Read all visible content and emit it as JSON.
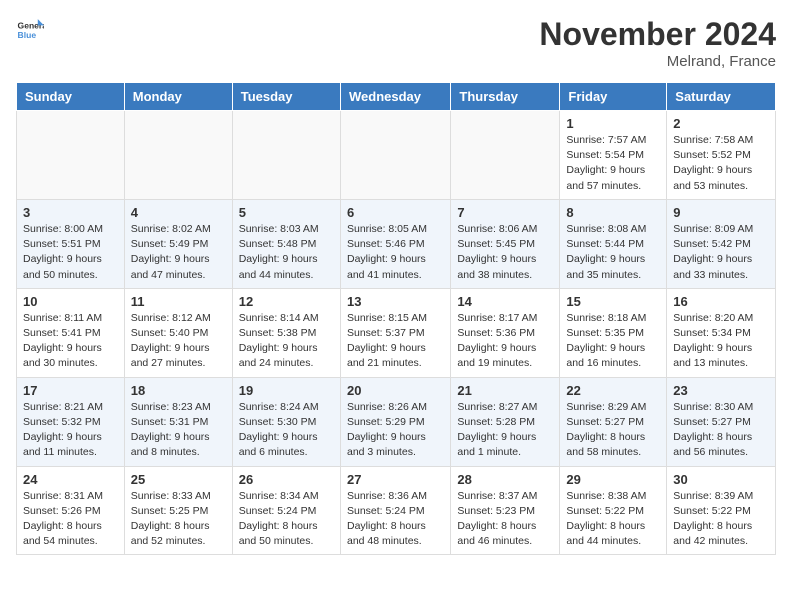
{
  "header": {
    "logo_line1": "General",
    "logo_line2": "Blue",
    "month_title": "November 2024",
    "location": "Melrand, France"
  },
  "days_of_week": [
    "Sunday",
    "Monday",
    "Tuesday",
    "Wednesday",
    "Thursday",
    "Friday",
    "Saturday"
  ],
  "weeks": [
    {
      "alt": false,
      "days": [
        {
          "num": "",
          "info": ""
        },
        {
          "num": "",
          "info": ""
        },
        {
          "num": "",
          "info": ""
        },
        {
          "num": "",
          "info": ""
        },
        {
          "num": "",
          "info": ""
        },
        {
          "num": "1",
          "info": "Sunrise: 7:57 AM\nSunset: 5:54 PM\nDaylight: 9 hours\nand 57 minutes."
        },
        {
          "num": "2",
          "info": "Sunrise: 7:58 AM\nSunset: 5:52 PM\nDaylight: 9 hours\nand 53 minutes."
        }
      ]
    },
    {
      "alt": true,
      "days": [
        {
          "num": "3",
          "info": "Sunrise: 8:00 AM\nSunset: 5:51 PM\nDaylight: 9 hours\nand 50 minutes."
        },
        {
          "num": "4",
          "info": "Sunrise: 8:02 AM\nSunset: 5:49 PM\nDaylight: 9 hours\nand 47 minutes."
        },
        {
          "num": "5",
          "info": "Sunrise: 8:03 AM\nSunset: 5:48 PM\nDaylight: 9 hours\nand 44 minutes."
        },
        {
          "num": "6",
          "info": "Sunrise: 8:05 AM\nSunset: 5:46 PM\nDaylight: 9 hours\nand 41 minutes."
        },
        {
          "num": "7",
          "info": "Sunrise: 8:06 AM\nSunset: 5:45 PM\nDaylight: 9 hours\nand 38 minutes."
        },
        {
          "num": "8",
          "info": "Sunrise: 8:08 AM\nSunset: 5:44 PM\nDaylight: 9 hours\nand 35 minutes."
        },
        {
          "num": "9",
          "info": "Sunrise: 8:09 AM\nSunset: 5:42 PM\nDaylight: 9 hours\nand 33 minutes."
        }
      ]
    },
    {
      "alt": false,
      "days": [
        {
          "num": "10",
          "info": "Sunrise: 8:11 AM\nSunset: 5:41 PM\nDaylight: 9 hours\nand 30 minutes."
        },
        {
          "num": "11",
          "info": "Sunrise: 8:12 AM\nSunset: 5:40 PM\nDaylight: 9 hours\nand 27 minutes."
        },
        {
          "num": "12",
          "info": "Sunrise: 8:14 AM\nSunset: 5:38 PM\nDaylight: 9 hours\nand 24 minutes."
        },
        {
          "num": "13",
          "info": "Sunrise: 8:15 AM\nSunset: 5:37 PM\nDaylight: 9 hours\nand 21 minutes."
        },
        {
          "num": "14",
          "info": "Sunrise: 8:17 AM\nSunset: 5:36 PM\nDaylight: 9 hours\nand 19 minutes."
        },
        {
          "num": "15",
          "info": "Sunrise: 8:18 AM\nSunset: 5:35 PM\nDaylight: 9 hours\nand 16 minutes."
        },
        {
          "num": "16",
          "info": "Sunrise: 8:20 AM\nSunset: 5:34 PM\nDaylight: 9 hours\nand 13 minutes."
        }
      ]
    },
    {
      "alt": true,
      "days": [
        {
          "num": "17",
          "info": "Sunrise: 8:21 AM\nSunset: 5:32 PM\nDaylight: 9 hours\nand 11 minutes."
        },
        {
          "num": "18",
          "info": "Sunrise: 8:23 AM\nSunset: 5:31 PM\nDaylight: 9 hours\nand 8 minutes."
        },
        {
          "num": "19",
          "info": "Sunrise: 8:24 AM\nSunset: 5:30 PM\nDaylight: 9 hours\nand 6 minutes."
        },
        {
          "num": "20",
          "info": "Sunrise: 8:26 AM\nSunset: 5:29 PM\nDaylight: 9 hours\nand 3 minutes."
        },
        {
          "num": "21",
          "info": "Sunrise: 8:27 AM\nSunset: 5:28 PM\nDaylight: 9 hours\nand 1 minute."
        },
        {
          "num": "22",
          "info": "Sunrise: 8:29 AM\nSunset: 5:27 PM\nDaylight: 8 hours\nand 58 minutes."
        },
        {
          "num": "23",
          "info": "Sunrise: 8:30 AM\nSunset: 5:27 PM\nDaylight: 8 hours\nand 56 minutes."
        }
      ]
    },
    {
      "alt": false,
      "days": [
        {
          "num": "24",
          "info": "Sunrise: 8:31 AM\nSunset: 5:26 PM\nDaylight: 8 hours\nand 54 minutes."
        },
        {
          "num": "25",
          "info": "Sunrise: 8:33 AM\nSunset: 5:25 PM\nDaylight: 8 hours\nand 52 minutes."
        },
        {
          "num": "26",
          "info": "Sunrise: 8:34 AM\nSunset: 5:24 PM\nDaylight: 8 hours\nand 50 minutes."
        },
        {
          "num": "27",
          "info": "Sunrise: 8:36 AM\nSunset: 5:24 PM\nDaylight: 8 hours\nand 48 minutes."
        },
        {
          "num": "28",
          "info": "Sunrise: 8:37 AM\nSunset: 5:23 PM\nDaylight: 8 hours\nand 46 minutes."
        },
        {
          "num": "29",
          "info": "Sunrise: 8:38 AM\nSunset: 5:22 PM\nDaylight: 8 hours\nand 44 minutes."
        },
        {
          "num": "30",
          "info": "Sunrise: 8:39 AM\nSunset: 5:22 PM\nDaylight: 8 hours\nand 42 minutes."
        }
      ]
    }
  ]
}
